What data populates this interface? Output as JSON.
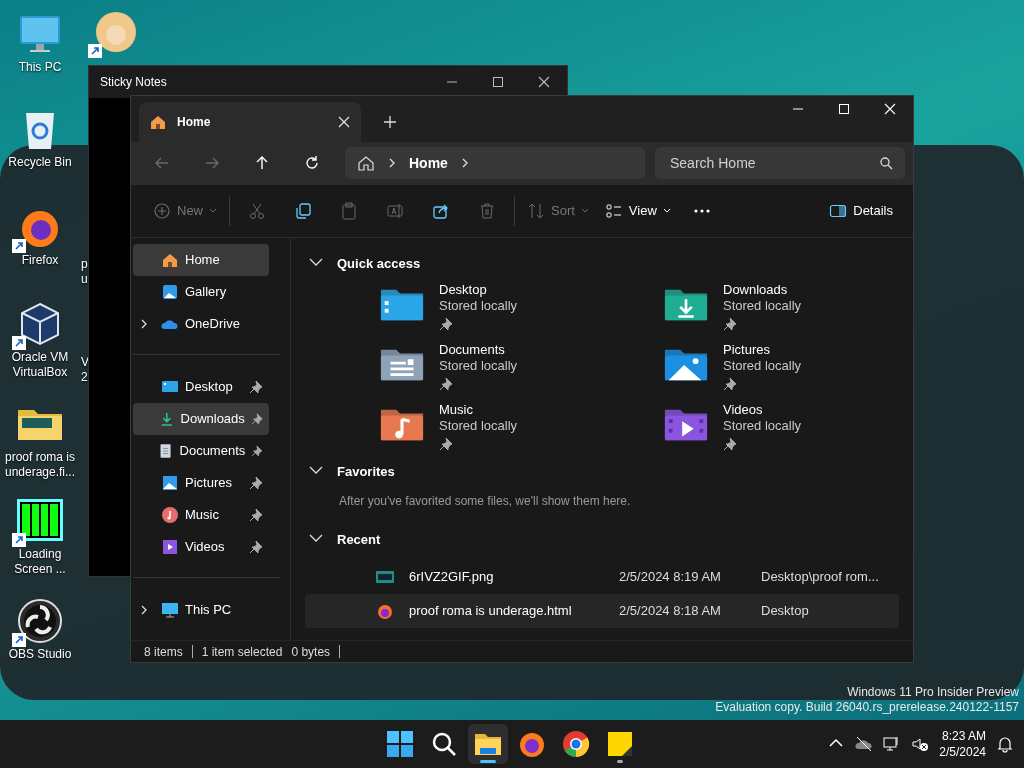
{
  "desktop_icons": [
    {
      "kind": "pc",
      "label": "This PC",
      "shortcut": false
    },
    {
      "kind": "bin",
      "label": "Recycle Bin",
      "shortcut": false
    },
    {
      "kind": "firefox",
      "label": "Firefox",
      "shortcut": true
    },
    {
      "kind": "vbox",
      "label": "Oracle VM VirtualBox",
      "shortcut": true
    },
    {
      "kind": "folder",
      "label": "proof roma is underage.fi...",
      "shortcut": false
    },
    {
      "kind": "loading",
      "label": "Loading Screen ...",
      "shortcut": true
    },
    {
      "kind": "obs",
      "label": "OBS Studio",
      "shortcut": true
    }
  ],
  "hidden_desktop_icons": [
    {
      "kind": "avatar",
      "shortcut": true
    },
    {
      "lines": [
        "p",
        "u"
      ]
    },
    {
      "lines": [
        "V",
        "2"
      ]
    }
  ],
  "sticky_notes": {
    "title": "Sticky Notes"
  },
  "explorer": {
    "tabs": [
      {
        "label": "Home",
        "selected": true
      }
    ],
    "nav": [
      {
        "kind": "back",
        "disabled": true
      },
      {
        "kind": "forward",
        "disabled": true
      },
      {
        "kind": "up",
        "disabled": false
      },
      {
        "kind": "refresh",
        "disabled": false
      }
    ],
    "breadcrumb": [
      "Home"
    ],
    "search": {
      "placeholder": "Search Home"
    },
    "toolbar": [
      {
        "kind": "new",
        "label": "New",
        "disabled": true,
        "dropdown": true,
        "separator_after": true
      },
      {
        "kind": "cut",
        "disabled": true
      },
      {
        "kind": "copy",
        "disabled": false
      },
      {
        "kind": "paste",
        "disabled": true
      },
      {
        "kind": "rename",
        "disabled": true
      },
      {
        "kind": "share",
        "disabled": false
      },
      {
        "kind": "delete",
        "disabled": true,
        "separator_after": true
      },
      {
        "kind": "sort",
        "label": "Sort",
        "disabled": true,
        "dropdown": true
      },
      {
        "kind": "view",
        "label": "View",
        "disabled": false,
        "dropdown": true
      },
      {
        "kind": "more",
        "disabled": false
      }
    ],
    "details_button": {
      "label": "Details"
    },
    "sidebar": [
      [
        {
          "kind": "home",
          "label": "Home",
          "highlighted": true,
          "expandable": false,
          "pinned": false
        },
        {
          "kind": "gallery",
          "label": "Gallery",
          "highlighted": false,
          "expandable": false,
          "pinned": false
        },
        {
          "kind": "onedrive",
          "label": "OneDrive",
          "highlighted": false,
          "expandable": true,
          "pinned": false
        }
      ],
      [
        {
          "kind": "desktop",
          "label": "Desktop",
          "highlighted": false,
          "expandable": false,
          "pinned": true
        },
        {
          "kind": "downloads",
          "label": "Downloads",
          "highlighted": true,
          "expandable": false,
          "pinned": true
        },
        {
          "kind": "documents",
          "label": "Documents",
          "highlighted": false,
          "expandable": false,
          "pinned": true
        },
        {
          "kind": "pictures",
          "label": "Pictures",
          "highlighted": false,
          "expandable": false,
          "pinned": true
        },
        {
          "kind": "music",
          "label": "Music",
          "highlighted": false,
          "expandable": false,
          "pinned": true
        },
        {
          "kind": "videos",
          "label": "Videos",
          "highlighted": false,
          "expandable": false,
          "pinned": true
        }
      ],
      [
        {
          "kind": "pc",
          "label": "This PC",
          "highlighted": false,
          "expandable": true,
          "pinned": false
        }
      ]
    ],
    "quick_access": {
      "title": "Quick access",
      "expanded": true,
      "items": [
        {
          "kind": "desktop",
          "name": "Desktop",
          "location": "Stored locally",
          "pinned": true
        },
        {
          "kind": "downloads",
          "name": "Downloads",
          "location": "Stored locally",
          "pinned": true
        },
        {
          "kind": "documents",
          "name": "Documents",
          "location": "Stored locally",
          "pinned": true
        },
        {
          "kind": "pictures",
          "name": "Pictures",
          "location": "Stored locally",
          "pinned": true
        },
        {
          "kind": "music",
          "name": "Music",
          "location": "Stored locally",
          "pinned": true
        },
        {
          "kind": "videos",
          "name": "Videos",
          "location": "Stored locally",
          "pinned": true
        }
      ]
    },
    "favorites": {
      "title": "Favorites",
      "expanded": true,
      "empty_text": "After you've favorited some files, we'll show them here."
    },
    "recent": {
      "title": "Recent",
      "expanded": true,
      "rows": [
        {
          "kind": "image",
          "name": "6rIVZ2GIF.png",
          "date": "2/5/2024 8:19 AM",
          "location": "Desktop\\proof rom...",
          "highlighted": false
        },
        {
          "kind": "html",
          "name": "proof roma is underage.html",
          "date": "2/5/2024 8:18 AM",
          "location": "Desktop",
          "highlighted": true
        }
      ]
    },
    "status_bar": [
      "8 items",
      "1 item selected",
      "0 bytes"
    ]
  },
  "watermark": [
    "Windows 11 Pro Insider Preview",
    "Evaluation copy. Build 26040.rs_prerelease.240122-1157"
  ],
  "taskbar": {
    "apps": [
      {
        "kind": "start",
        "running": false,
        "active": false
      },
      {
        "kind": "search",
        "running": false,
        "active": false
      },
      {
        "kind": "explorer",
        "running": true,
        "active": true
      },
      {
        "kind": "firefox",
        "running": false,
        "active": false
      },
      {
        "kind": "chrome",
        "running": false,
        "active": false
      },
      {
        "kind": "sticky",
        "running": true,
        "active": false
      }
    ],
    "tray": [
      {
        "kind": "chevron"
      },
      {
        "kind": "cloud-off"
      },
      {
        "kind": "network"
      },
      {
        "kind": "volume-muted"
      }
    ],
    "time": "8:23 AM",
    "date": "2/5/2024"
  }
}
